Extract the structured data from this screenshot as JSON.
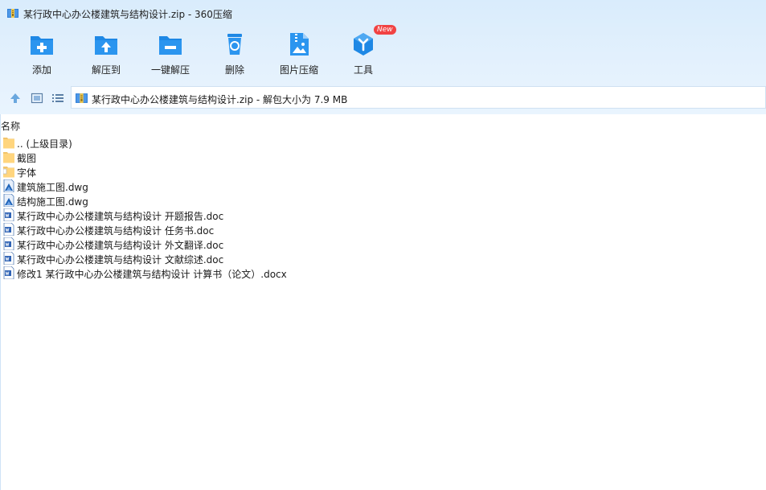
{
  "window": {
    "title": "某行政中心办公楼建筑与结构设计.zip - 360压缩"
  },
  "toolbar": [
    {
      "label": "添加",
      "icon": "add-folder-icon"
    },
    {
      "label": "解压到",
      "icon": "extract-to-icon"
    },
    {
      "label": "一键解压",
      "icon": "one-click-extract-icon"
    },
    {
      "label": "删除",
      "icon": "delete-icon"
    },
    {
      "label": "图片压缩",
      "icon": "image-compress-icon"
    },
    {
      "label": "工具",
      "icon": "tools-icon",
      "badge": "New"
    }
  ],
  "nav": {
    "address": "某行政中心办公楼建筑与结构设计.zip - 解包大小为 7.9 MB"
  },
  "list": {
    "column_name": "名称",
    "items": [
      {
        "name": ".. (上级目录)",
        "type": "folder"
      },
      {
        "name": "截图",
        "type": "folder"
      },
      {
        "name": "字体",
        "type": "folder-file"
      },
      {
        "name": "建筑施工图.dwg",
        "type": "dwg"
      },
      {
        "name": "结构施工图.dwg",
        "type": "dwg"
      },
      {
        "name": "某行政中心办公楼建筑与结构设计 开题报告.doc",
        "type": "doc"
      },
      {
        "name": "某行政中心办公楼建筑与结构设计 任务书.doc",
        "type": "doc"
      },
      {
        "name": "某行政中心办公楼建筑与结构设计 外文翻译.doc",
        "type": "doc"
      },
      {
        "name": "某行政中心办公楼建筑与结构设计 文献综述.doc",
        "type": "doc"
      },
      {
        "name": "修改1 某行政中心办公楼建筑与结构设计 计算书（论文）.docx",
        "type": "doc"
      }
    ]
  },
  "colors": {
    "accent": "#1e88e5",
    "chrome_bg": "#dcedfc",
    "badge": "#f14343"
  }
}
